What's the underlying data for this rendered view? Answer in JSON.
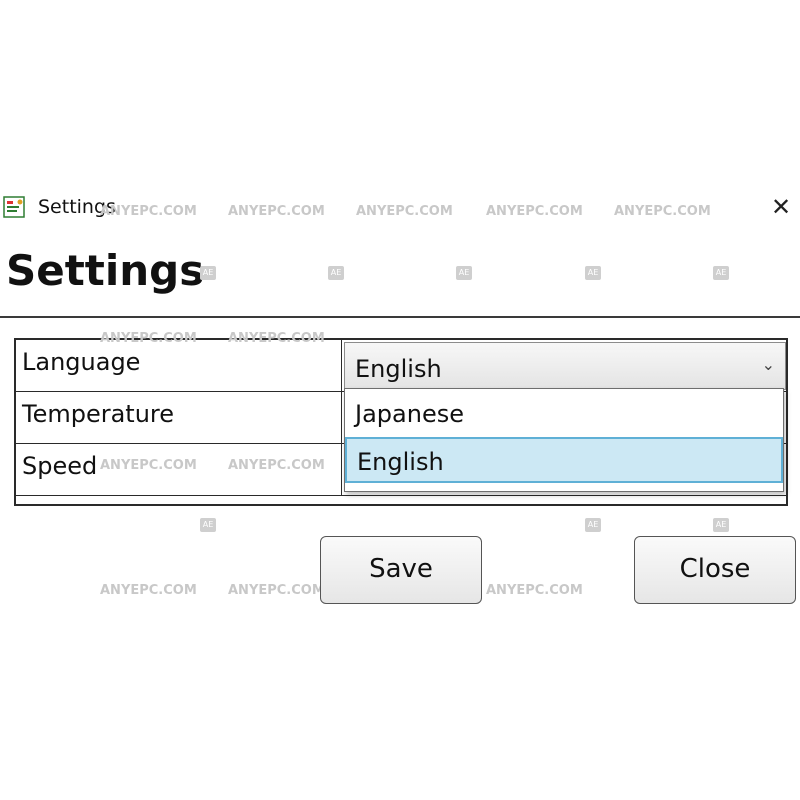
{
  "window": {
    "title": "Settings",
    "close_glyph": "✕"
  },
  "heading": "Settings",
  "rows": [
    {
      "label": "Language",
      "value": "English"
    },
    {
      "label": "Temperature",
      "value": ""
    },
    {
      "label": "Speed",
      "value": ""
    }
  ],
  "language_combo": {
    "selected": "English",
    "arrow": "⌄",
    "options": [
      "Japanese",
      "English"
    ],
    "highlighted_option": "English"
  },
  "buttons": {
    "save": "Save",
    "close": "Close"
  },
  "watermark": {
    "text": "ANYEPC.COM",
    "badge": "AE"
  },
  "icons": {
    "app": "app-settings-icon",
    "close": "close-icon",
    "dropdown": "chevron-down-icon"
  }
}
